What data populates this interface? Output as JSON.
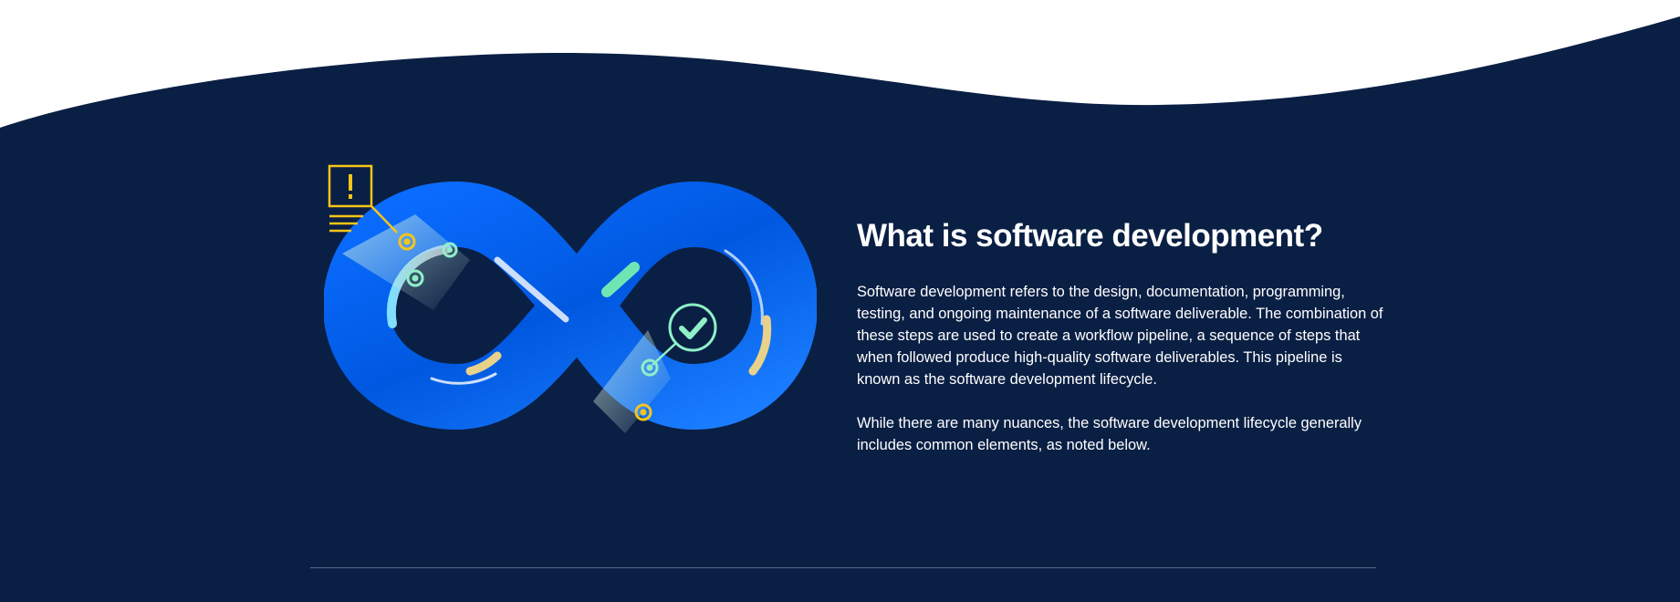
{
  "section": {
    "title": "What is software development?",
    "paragraphs": [
      "Software development refers to the design, documentation, programming, testing, and ongoing maintenance of a software deliverable. The combination of these steps are used to create a workflow pipeline, a sequence of steps that when followed produce high-quality software deliverables. This pipeline is known as the software development lifecycle.",
      "While there are many nuances, the software development lifecycle generally includes common elements, as noted below."
    ]
  },
  "illustration": {
    "icons": [
      "alert-icon",
      "checkmark-icon",
      "infinity-loop"
    ]
  },
  "colors": {
    "navy_background": "#0a1f44",
    "loop_blue": "#0065ff",
    "accent_yellow": "#f5c518",
    "accent_green": "#6ee6b4"
  }
}
